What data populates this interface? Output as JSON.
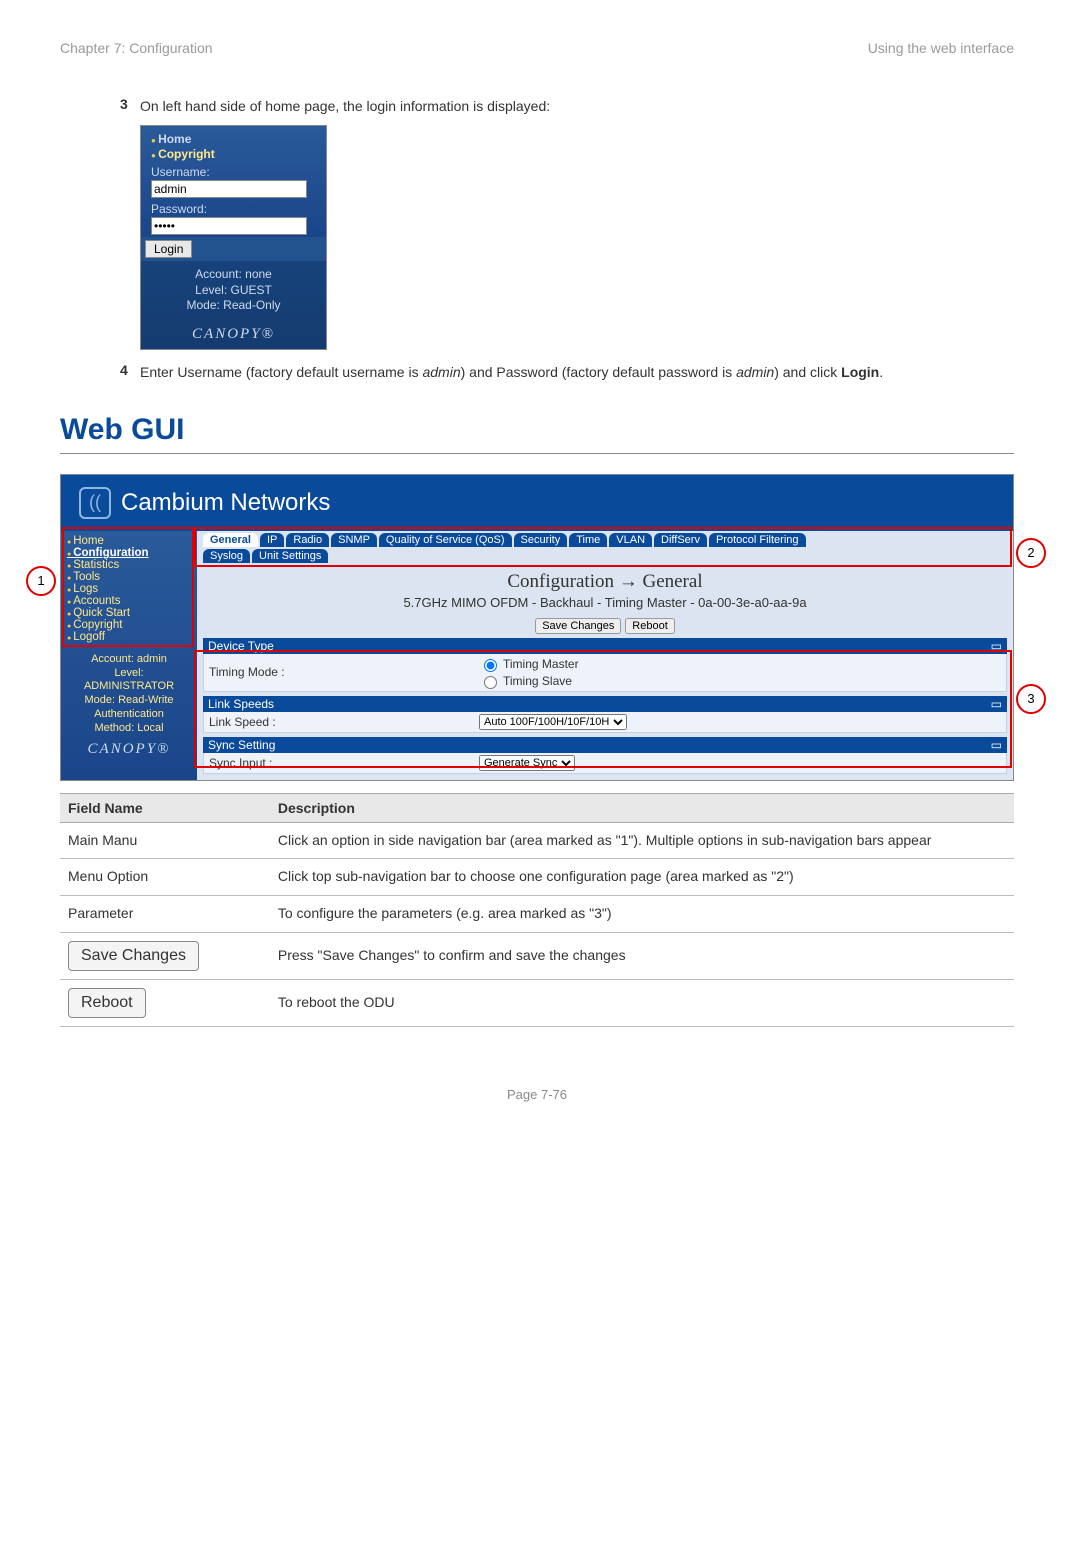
{
  "header": {
    "left": "Chapter 7:  Configuration",
    "right": "Using the web interface"
  },
  "steps": {
    "s3num": "3",
    "s3text": "On left hand side of home page, the login information is displayed:",
    "s4num": "4",
    "s4a": "Enter Username (factory default username is ",
    "s4i1": "admin",
    "s4b": ") and Password (factory default password is ",
    "s4i2": "admin",
    "s4c": ") and click ",
    "s4btn": "Login",
    "s4d": "."
  },
  "login": {
    "home": "Home",
    "copy": "Copyright",
    "user_label": "Username:",
    "user_value": "admin",
    "pass_label": "Password:",
    "pass_value": "•••••",
    "btn": "Login",
    "acc1": "Account: none",
    "acc2": "Level: GUEST",
    "acc3": "Mode: Read-Only",
    "canopy": "CANOPY®"
  },
  "h2": "Web GUI",
  "gui": {
    "brand": "Cambium Networks",
    "side": [
      "Home",
      "Configuration",
      "Statistics",
      "Tools",
      "Logs",
      "Accounts",
      "Quick Start",
      "Copyright",
      "Logoff"
    ],
    "side_sel_index": 1,
    "side_acc": [
      "Account: admin",
      "Level:",
      "ADMINISTRATOR",
      "Mode: Read-Write",
      "Authentication",
      "Method: Local"
    ],
    "side_canopy": "CANOPY®",
    "tabs1": [
      "General",
      "IP",
      "Radio",
      "SNMP",
      "Quality of Service (QoS)",
      "Security",
      "Time",
      "VLAN",
      "DiffServ",
      "Protocol Filtering"
    ],
    "tabs2": [
      "Syslog",
      "Unit Settings"
    ],
    "tabs_sel_index": 0,
    "title": "Configuration → General",
    "sub": "5.7GHz MIMO OFDM - Backhaul - Timing Master - 0a-00-3e-a0-aa-9a",
    "save": "Save Changes",
    "reboot": "Reboot",
    "sec1": "Device Type",
    "p1label": "Timing Mode :",
    "p1opt1": "Timing Master",
    "p1opt2": "Timing Slave",
    "sec2": "Link Speeds",
    "p2label": "Link Speed :",
    "p2val": "Auto 100F/100H/10F/10H",
    "sec3": "Sync Setting",
    "p3label": "Sync Input :",
    "p3val": "Generate Sync"
  },
  "markers": {
    "m1": "1",
    "m2": "2",
    "m3": "3"
  },
  "table": {
    "h1": "Field Name",
    "h2": "Description",
    "r1a": "Main Manu",
    "r1b": "Click an option in side navigation bar (area marked as \"1\"). Multiple options in sub-navigation bars appear",
    "r2a": "Menu Option",
    "r2b": "Click top sub-navigation bar to choose one configuration page (area marked as \"2\")",
    "r3a": "Parameter",
    "r3b": "To configure the parameters (e.g. area marked as \"3\")",
    "r4btn": "Save Changes",
    "r4b": "Press \"Save Changes\" to confirm and save the changes",
    "r5btn": "Reboot",
    "r5b": "To reboot the ODU"
  },
  "footer": "Page 7-76"
}
